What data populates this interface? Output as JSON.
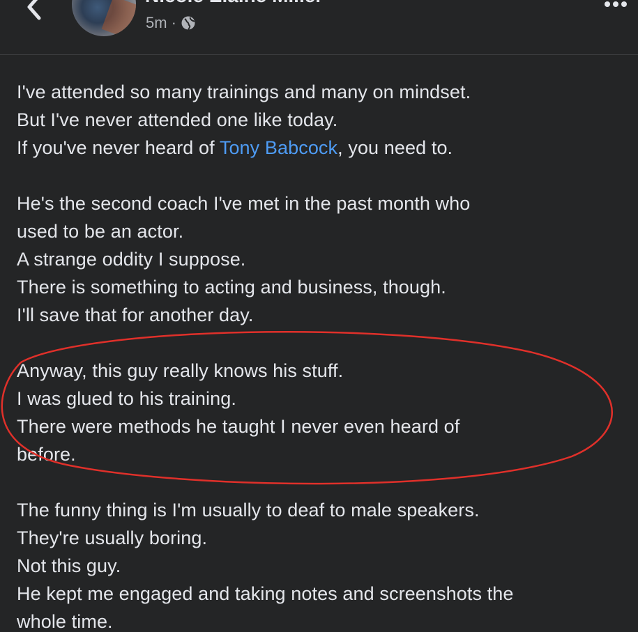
{
  "header": {
    "author_name": "Nicole Elaine Miller",
    "timestamp": "5m",
    "separator": "·",
    "privacy_icon": "globe-icon",
    "back_icon": "chevron-left-icon",
    "more_icon": "more-horizontal-icon"
  },
  "post": {
    "p1": {
      "line1": "I've attended so many trainings and many on mindset.",
      "line2": "But I've never attended one like today.",
      "line3_before": "If you've never heard of ",
      "line3_mention": "Tony Babcock",
      "line3_after": ", you need to."
    },
    "p2": [
      "He's the second coach I've met in the past month who",
      "used to be an actor.",
      "A strange oddity I suppose.",
      "There is something to acting and business, though.",
      "I'll save that for another day."
    ],
    "p3": [
      "Anyway, this guy really knows his stuff.",
      "I was glued to his training.",
      "There were methods he taught I never even heard of",
      "before."
    ],
    "p4": [
      "The funny thing is I'm usually to deaf to male speakers.",
      "They're usually boring.",
      "Not this guy.",
      "He kept me engaged and taking notes and screenshots the",
      "whole time."
    ]
  },
  "colors": {
    "background": "#242526",
    "text": "#e4e6eb",
    "secondary_text": "#b0b3b8",
    "mention": "#4e9cf5",
    "annotation_circle": "#e0302a"
  }
}
